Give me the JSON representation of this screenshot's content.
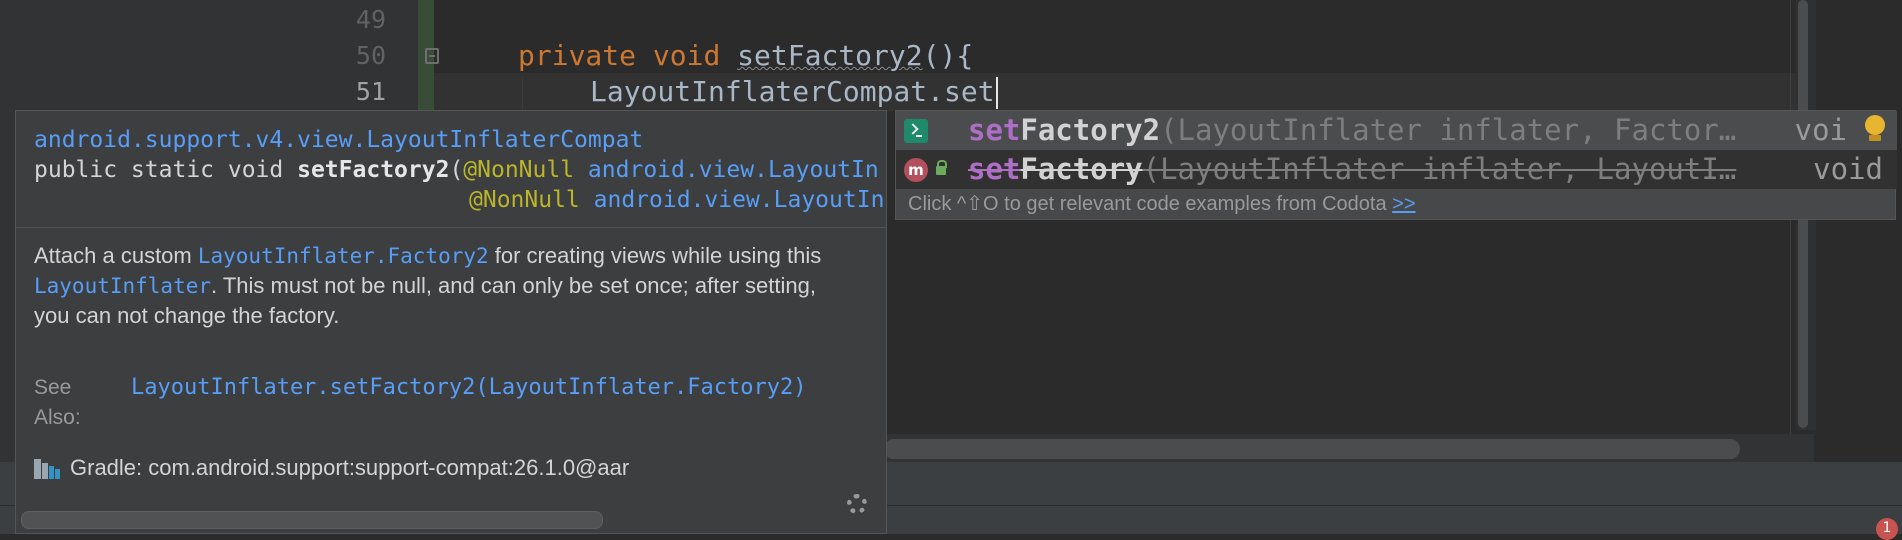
{
  "editor": {
    "line_numbers": [
      "49",
      "50",
      "51"
    ],
    "lines": {
      "line50_kw1": "private",
      "line50_kw2": "void",
      "line50_name": "setFactory2",
      "line50_rest": "(){",
      "line51_text": "LayoutInflaterCompat.set"
    },
    "error_count": "1"
  },
  "completion": {
    "items": [
      {
        "icon": "console-icon",
        "match": "set",
        "name": "Factory2",
        "params": "(LayoutInflater inflater, Factor…",
        "type": "voi",
        "deprecated": false
      },
      {
        "icon": "method-icon",
        "icon_letter": "m",
        "match": "set",
        "name": "Factory",
        "params": "(LayoutInflater inflater, LayoutI…",
        "type": "void",
        "deprecated": true
      }
    ],
    "hint_text": "Click ^⇧O to get relevant code examples from Codota ",
    "hint_link": ">>"
  },
  "documentation": {
    "class_link": "android.support.v4.view.LayoutInflaterCompat",
    "sig_prefix": "public static void ",
    "sig_method": "setFactory2",
    "sig_open": "(",
    "param1_ann": "@NonNull",
    "param1_type": " android.view.LayoutIn",
    "param2_ann": "@NonNull",
    "param2_type": " android.view.LayoutIn",
    "body": {
      "part1": "Attach a custom ",
      "link1": "LayoutInflater.Factory2",
      "part2": " for creating views while using this ",
      "link2": "LayoutInflater",
      "part3": ". This must not be null, and can only be set once; after setting, you can not change the factory."
    },
    "see_also_label": "See Also:",
    "see_also_value": "LayoutInflater.setFactory2(LayoutInflater.Factory2)",
    "gradle_text": "Gradle: com.android.support:support-compat:26.1.0@aar"
  },
  "colors": {
    "background": "#2b2b2b",
    "keyword": "#cc7832",
    "link": "#589df6",
    "match": "#b06fc7",
    "annotation": "#bbb529"
  }
}
